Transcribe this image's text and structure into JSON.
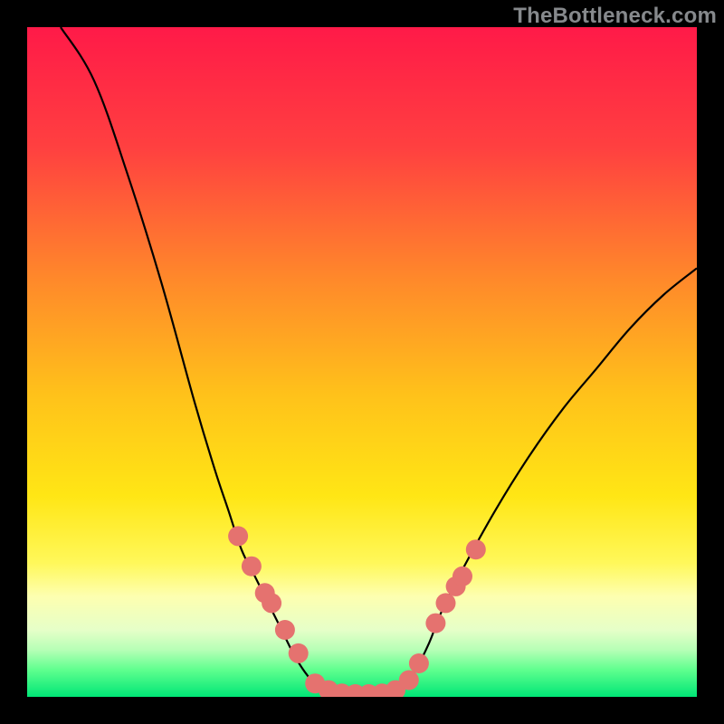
{
  "watermark": "TheBottleneck.com",
  "chart_data": {
    "type": "line",
    "title": "",
    "xlabel": "",
    "ylabel": "",
    "xlim": [
      0,
      100
    ],
    "ylim": [
      0,
      100
    ],
    "grid": false,
    "series": [
      {
        "name": "left-curve",
        "x": [
          5,
          10,
          15,
          20,
          25,
          28,
          30,
          32,
          34,
          36,
          38,
          40,
          42,
          44
        ],
        "y": [
          100,
          92,
          78,
          62,
          44,
          34,
          28,
          22,
          18,
          14,
          10,
          6,
          3,
          1
        ]
      },
      {
        "name": "valley-floor",
        "x": [
          44,
          46,
          48,
          50,
          52,
          54,
          56
        ],
        "y": [
          1,
          0.5,
          0.3,
          0.3,
          0.3,
          0.5,
          1
        ]
      },
      {
        "name": "right-curve",
        "x": [
          56,
          58,
          60,
          62,
          65,
          70,
          75,
          80,
          85,
          90,
          95,
          100
        ],
        "y": [
          1,
          4,
          8,
          13,
          19,
          28,
          36,
          43,
          49,
          55,
          60,
          64
        ]
      }
    ],
    "markers": {
      "name": "highlighted-points",
      "x": [
        31.5,
        33.5,
        35.5,
        36.5,
        38.5,
        40.5,
        43,
        45,
        47,
        49,
        51,
        53,
        55,
        57,
        58.5,
        61,
        62.5,
        64,
        65,
        67
      ],
      "y": [
        24,
        19.5,
        15.5,
        14,
        10,
        6.5,
        2,
        1,
        0.5,
        0.4,
        0.4,
        0.5,
        1,
        2.5,
        5,
        11,
        14,
        16.5,
        18,
        22
      ]
    },
    "background_gradient": {
      "type": "linear-vertical",
      "stops": [
        {
          "offset": 0.0,
          "color": "#ff1a48"
        },
        {
          "offset": 0.18,
          "color": "#ff4040"
        },
        {
          "offset": 0.38,
          "color": "#ff8a2a"
        },
        {
          "offset": 0.55,
          "color": "#ffc21a"
        },
        {
          "offset": 0.7,
          "color": "#ffe615"
        },
        {
          "offset": 0.8,
          "color": "#fff85a"
        },
        {
          "offset": 0.85,
          "color": "#fdffb0"
        },
        {
          "offset": 0.9,
          "color": "#e6ffc8"
        },
        {
          "offset": 0.93,
          "color": "#b6ffb6"
        },
        {
          "offset": 0.96,
          "color": "#5eff8e"
        },
        {
          "offset": 1.0,
          "color": "#00e676"
        }
      ]
    },
    "line_color": "#000000",
    "marker_color": "#e5726f",
    "marker_radius": 11
  }
}
